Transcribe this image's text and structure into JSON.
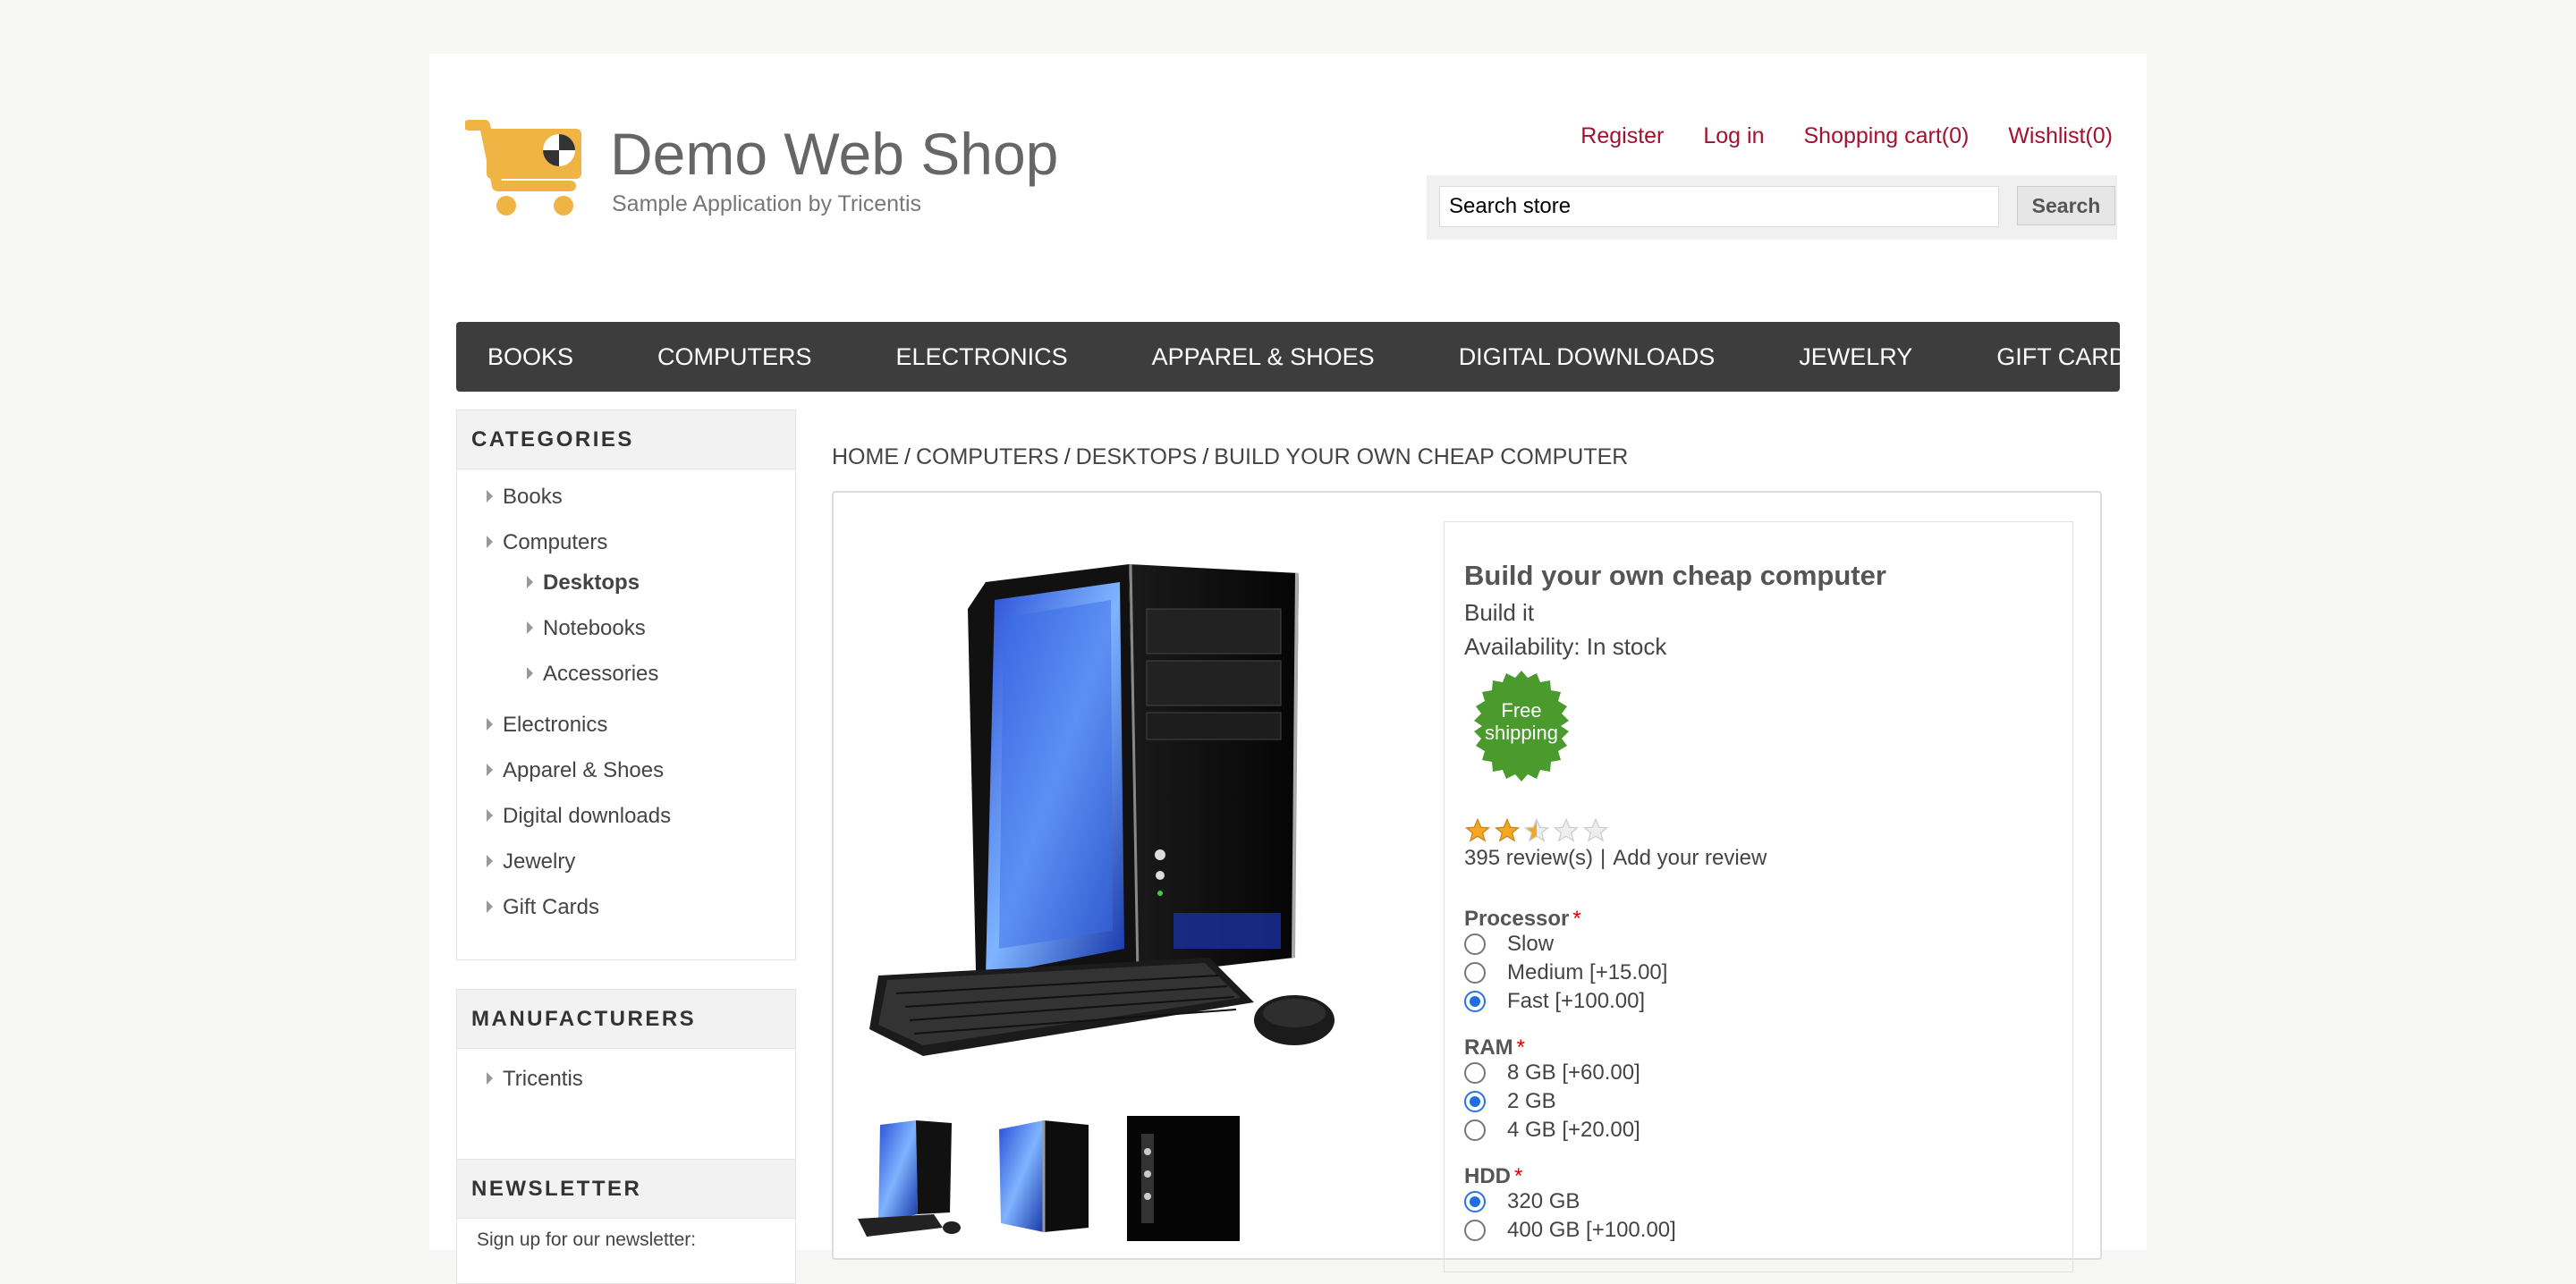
{
  "header": {
    "brand": "Demo Web Shop",
    "tagline": "Sample Application by Tricentis",
    "links": {
      "register": "Register",
      "login": "Log in",
      "cart": "Shopping cart(0)",
      "wishlist": "Wishlist(0)"
    },
    "search": {
      "value": "Search store",
      "button": "Search"
    }
  },
  "topmenu": [
    "BOOKS",
    "COMPUTERS",
    "ELECTRONICS",
    "APPAREL & SHOES",
    "DIGITAL DOWNLOADS",
    "JEWELRY",
    "GIFT CARDS"
  ],
  "sidebar": {
    "categories": {
      "title": "CATEGORIES",
      "items": [
        {
          "label": "Books"
        },
        {
          "label": "Computers"
        },
        {
          "label": "Desktops",
          "active": true
        },
        {
          "label": "Notebooks"
        },
        {
          "label": "Accessories"
        },
        {
          "label": "Electronics"
        },
        {
          "label": "Apparel & Shoes"
        },
        {
          "label": "Digital downloads"
        },
        {
          "label": "Jewelry"
        },
        {
          "label": "Gift Cards"
        }
      ]
    },
    "manufacturers": {
      "title": "MANUFACTURERS",
      "items": [
        "Tricentis"
      ]
    },
    "newsletter": {
      "title": "NEWSLETTER",
      "text": "Sign up for our newsletter:"
    }
  },
  "breadcrumb": [
    "HOME",
    "COMPUTERS",
    "DESKTOPS",
    "BUILD YOUR OWN CHEAP COMPUTER"
  ],
  "product": {
    "title": "Build your own cheap computer",
    "short_description": "Build it",
    "availability": "Availability: In stock",
    "badge": {
      "line1": "Free",
      "line2": "shipping",
      "color": "#4a9a2e"
    },
    "rating_fraction": 0.5,
    "reviews": "395 review(s)",
    "add_review": "Add your review",
    "attributes": {
      "processor": {
        "label": "Processor",
        "options": [
          "Slow",
          "Medium [+15.00]",
          "Fast [+100.00]"
        ],
        "selected": "Fast [+100.00]"
      },
      "ram": {
        "label": "RAM",
        "options": [
          "8 GB [+60.00]",
          "2 GB",
          "4 GB [+20.00]"
        ],
        "selected": "2 GB"
      },
      "hdd": {
        "label": "HDD",
        "options": [
          "320 GB",
          "400 GB [+100.00]"
        ],
        "selected": "320 GB"
      }
    },
    "required_mark": "*"
  },
  "colors": {
    "link": "#a4102f",
    "menu_bg": "#3d3d3d",
    "selected_radio": "#1b6fe3",
    "star": "#f5a623"
  }
}
